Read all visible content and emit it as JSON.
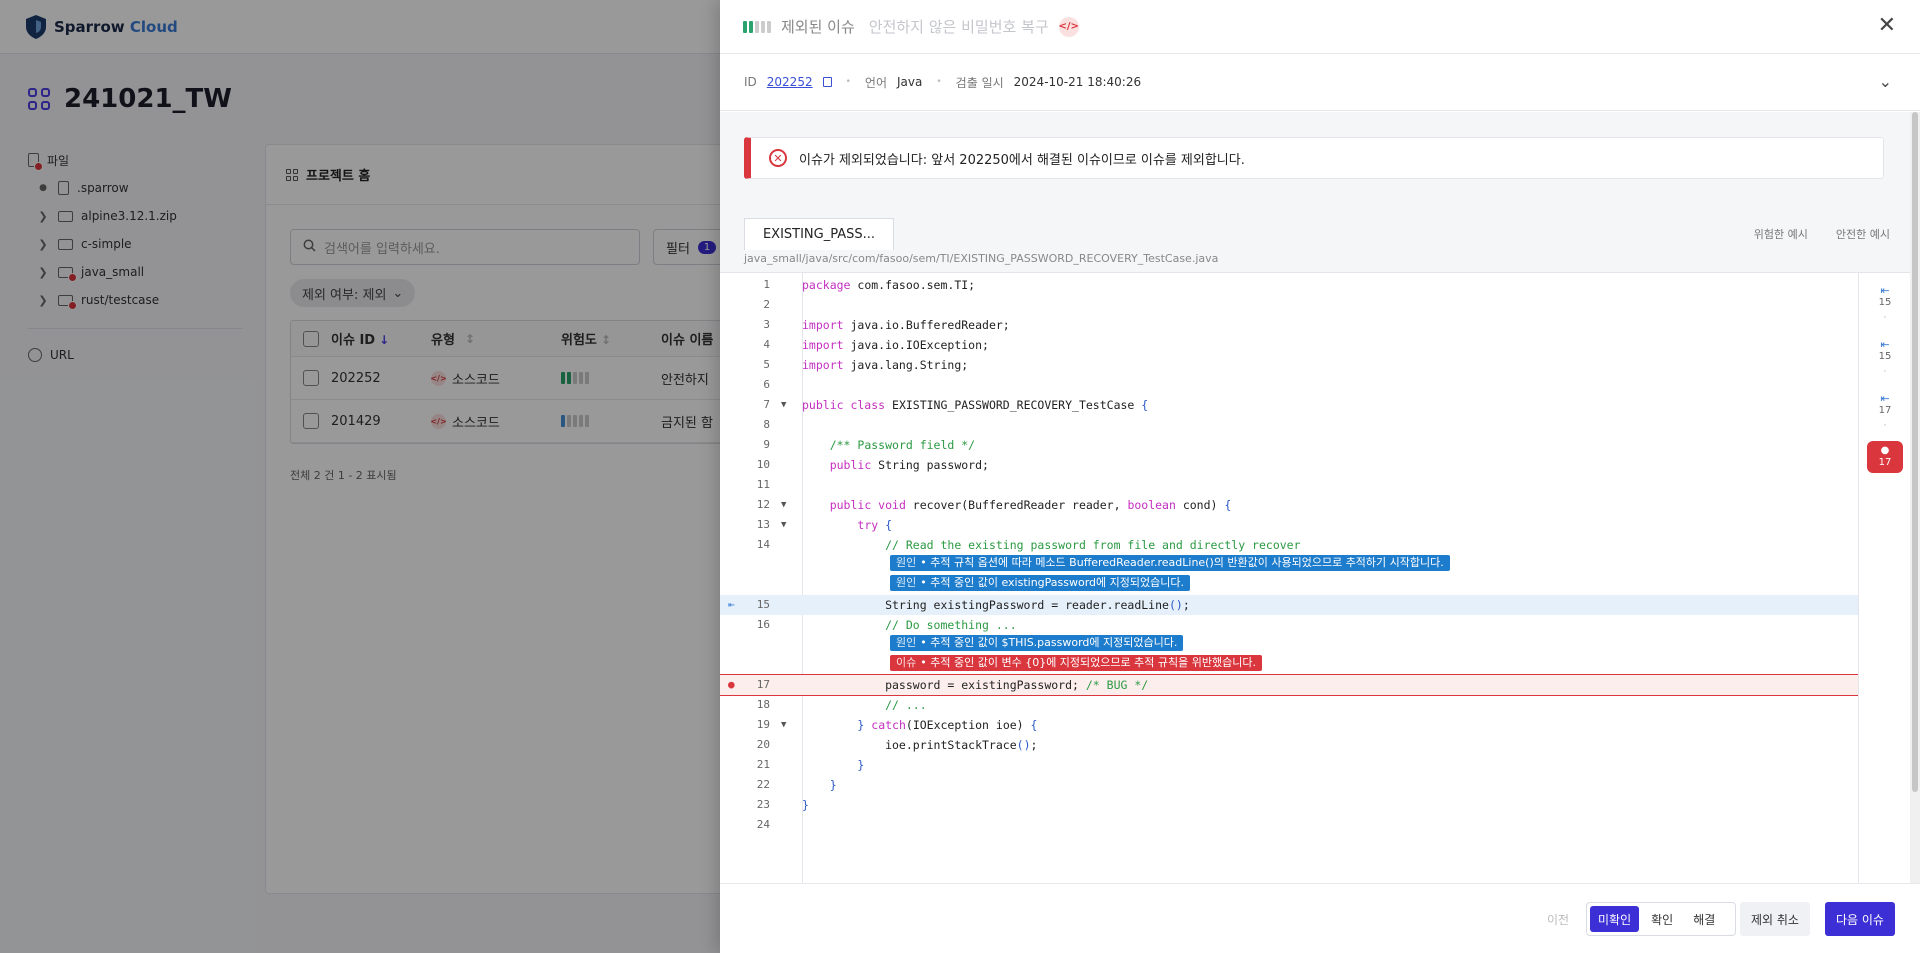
{
  "app": {
    "logo_text": "Sparrow",
    "logo_text_accent": "Cloud"
  },
  "project": {
    "name": "241021_TW"
  },
  "tree": {
    "section_file": "파일",
    "items": [
      {
        "label": ".sparrow"
      },
      {
        "label": "alpine3.12.1.zip"
      },
      {
        "label": "c-simple"
      },
      {
        "label": "java_small"
      },
      {
        "label": "rust/testcase"
      }
    ],
    "url_label": "URL"
  },
  "card": {
    "title": "프로젝트 홈",
    "search_placeholder": "검색어를 입력하세요.",
    "filter_label": "필터",
    "filter_count": "1",
    "chip_label": "제외 여부: 제외",
    "columns": {
      "id": "이슈 ID",
      "type": "유형",
      "risk": "위험도",
      "name": "이슈 이름"
    },
    "rows": [
      {
        "id": "202252",
        "type": "소스코드",
        "name": "안전하지"
      },
      {
        "id": "201429",
        "type": "소스코드",
        "name": "금지된 함"
      }
    ],
    "footer": "전체 2 건   1 - 2 표시됨"
  },
  "drawer": {
    "status_title": "제외된 이슈",
    "issue_title": "안전하지 않은 비밀번호 복구",
    "meta": {
      "id_label": "ID",
      "id_value": "202252",
      "lang_label": "언어",
      "lang_value": "Java",
      "date_label": "검출 일시",
      "date_value": "2024-10-21 18:40:26"
    },
    "alert": "이슈가 제외되었습니다: 앞서 202250에서 해결된 이슈이므로 이슈를 제외합니다.",
    "code_tab": "EXISTING_PASS...",
    "example_bad": "위험한 예시",
    "example_good": "안전한 예시",
    "file_path": "java_small/java/src/com/fasoo/sem/TI/EXISTING_PASSWORD_RECOVERY_TestCase.java",
    "annotations": [
      {
        "tag": "원인",
        "text": "추적 규칙 옵션에 따라 메소드 BufferedReader.readLine()의 반환값이 사용되었으므로 추적하기 시작합니다."
      },
      {
        "tag": "원인",
        "text": "추적 중인 값이 existingPassword에 지정되었습니다."
      },
      {
        "tag": "원인",
        "text": "추적 중인 값이 $THIS.password에 지정되었습니다."
      },
      {
        "tag": "이슈",
        "text": "추적 중인 값이 변수 {0}에 지정되었으므로 추적 규칙을 위반했습니다."
      }
    ],
    "nav_markers": [
      "15",
      "15",
      "17",
      "17"
    ],
    "footer": {
      "prev": "이전",
      "seg_unconfirmed": "미확인",
      "seg_confirmed": "확인",
      "seg_resolved": "해결",
      "cancel_exclude": "제외 취소",
      "next": "다음 이슈"
    }
  }
}
